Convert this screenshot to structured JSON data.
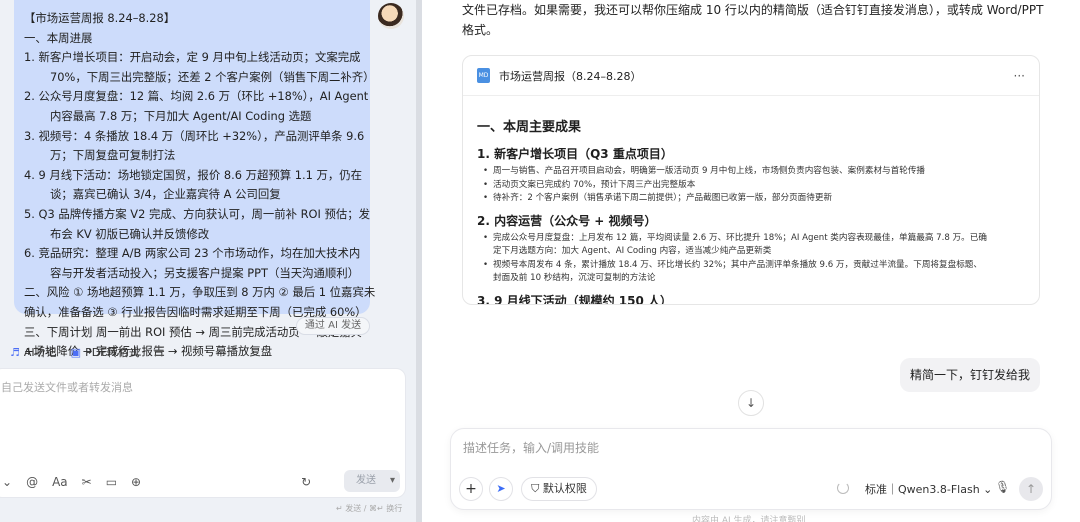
{
  "left": {
    "summary_lines": [
      "【市场运营周报 8.24–8.28】",
      "一、本周进展",
      "1.  新客户增长项目：开启动会，定 9 月中旬上线活动页；文案完成",
      "70%，下周三出完整版；还差 2 个客户案例（销售下周二补齐）",
      "2.  公众号月度复盘：12 篇、均阅 2.6 万（环比 +18%），AI Agent",
      "内容最高 7.8 万；下月加大 Agent/AI Coding 选题",
      "3.  视频号：4 条播放 18.4 万（周环比 +32%），产品测评单条 9.6",
      "万；下周复盘可复制打法",
      "4.  9 月线下活动：场地锁定国贸，报价 8.6 万超预算 1.1 万，仍在",
      "谈；嘉宾已确认 3/4，企业嘉宾待 A 公司回复",
      "5.  Q3 品牌传播方案 V2 完成、方向获认可，周一前补 ROI 预估；发",
      "布会 KV 初版已确认并反馈修改",
      "6.  竞品研究：整理 A/B 两家公司 23 个市场动作，均在加大技术内",
      "容与开发者活动投入；另支援客户提案 PPT（当天沟通顺利）",
      "二、风险 ① 场地超预算 1.1 万，争取压到 8 万内 ② 最后 1 位嘉宾未",
      "确认，准备备选 ③ 行业报告因临时需求延期至下周（已完成 60%）",
      "三、下周计划 周一前出 ROI 预估 → 周三前完成活动页 → 敲定嘉宾",
      "+场地降价 → 完成行业报告 → 视频号幕播放复盘"
    ],
    "indented_lines": [
      3,
      5,
      7,
      9,
      11,
      13
    ],
    "sent_via": "通过 AI 发送",
    "tools": {
      "listen": "AI听记",
      "pdf": "PDF转格式"
    },
    "composer_placeholder": "自己发送文件或者转发消息",
    "send_label": "发送",
    "hint": "↵ 发送 / ⌘↵ 换行"
  },
  "right": {
    "ai_text_line1": "文件已存档。如果需要，我还可以帮你压缩成 10 行以内的精简版（适合钉钉直接发消息），或转成 Word/PPT",
    "ai_text_line2": "格式。",
    "doc": {
      "icon_label": "MD",
      "title": "市场运营周报（8.24–8.28）",
      "more": "···",
      "h1": "一、本周主要成果",
      "sec1_title": "1. 新客户增长项目（Q3 重点项目）",
      "sec1_items": [
        "周一与销售、产品召开项目启动会，明确第一版活动页 9 月中旬上线，市场侧负责内容包装、案例素材与首轮传播",
        "活动页文案已完成约 70%，预计下周三产出完整版本",
        "待补齐：2 个客户案例（销售承诺下周二前提供）；产品截图已收第一版，部分页面待更新"
      ],
      "sec2_title": "2. 内容运营（公众号 + 视频号）",
      "sec2_items": [
        "完成公众号月度复盘：上月发布 12 篇，平均阅读量 2.6 万、环比提升 18%；AI Agent 类内容表现最佳，单篇最高 7.8 万。已确",
        "定下月选题方向：加大 Agent、AI Coding 内容，适当减少纯产品更新类",
        "视频号本周发布 4 条，累计播放 18.4 万、环比增长约 32%；其中产品测评单条播放 9.6 万，贡献过半流量。下周将复盘标题、",
        "封面及前 10 秒结构，沉淀可复制的方法论"
      ],
      "sec3_title": "3. 9 月线下活动（规模约 150 人）"
    },
    "user_message": "精简一下，钉钉发给我",
    "composer_placeholder": "描述任务，输入/调用技能",
    "permission_label": "默认权限",
    "model_label": "标准｜Qwen3.8-Flash ⌄",
    "footer_note": "内容由 AI 生成，请注意甄别"
  }
}
